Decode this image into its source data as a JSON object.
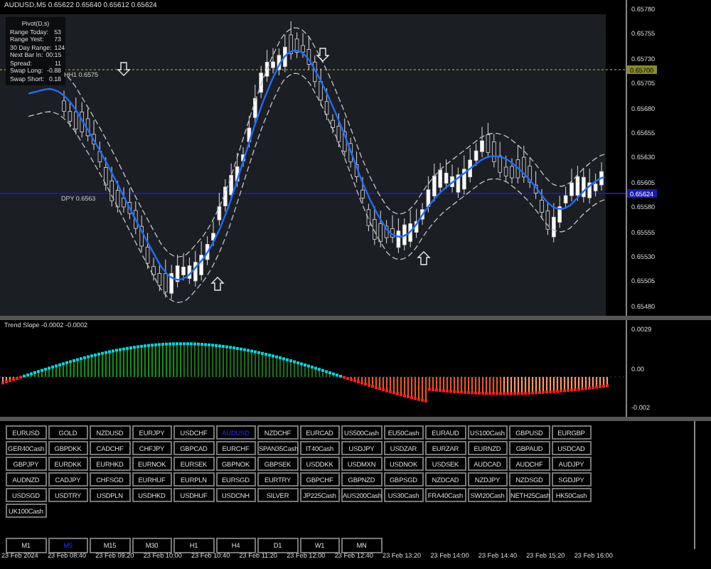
{
  "window": {
    "title": "AUDUSD,M5 0.65622 0.65640 0.65612 0.65624"
  },
  "info_panel": {
    "title": "Pivot(D,s)",
    "rows": [
      {
        "label": "Range Today:",
        "value": "53"
      },
      {
        "label": "Range Yest:",
        "value": "73"
      },
      {
        "label": "30 Day Range:",
        "value": "124"
      },
      {
        "label": "Next Bar In:",
        "value": "00:15"
      },
      {
        "label": "Spread:",
        "value": "11"
      },
      {
        "label": "Swap Long:",
        "value": "-0.88"
      },
      {
        "label": "Swap Short:",
        "value": "0.18"
      }
    ]
  },
  "levels": [
    {
      "kind": "dotted",
      "label": "HH1  0.6575",
      "price_label": "0.65700"
    },
    {
      "kind": "solid",
      "label": "DPY  0.6563",
      "price_label": "0.65624"
    }
  ],
  "price_axis": [
    "0.65780",
    "0.65755",
    "0.65730",
    "0.65705",
    "0.65680",
    "0.65655",
    "0.65630",
    "0.65605",
    "0.65580",
    "0.65555",
    "0.65530",
    "0.65505",
    "0.65480"
  ],
  "indicator": {
    "title": "Trend Slope -0.0002 -0.0002",
    "axis": [
      "0.0029",
      "0.00",
      "-0.002"
    ]
  },
  "symbols": [
    {
      "label": "EURUSD",
      "selected": false
    },
    {
      "label": "GOLD",
      "selected": false
    },
    {
      "label": "NZDUSD",
      "selected": false
    },
    {
      "label": "EURJPY",
      "selected": false
    },
    {
      "label": "USDCHF",
      "selected": false
    },
    {
      "label": "AUDUSD",
      "selected": true
    },
    {
      "label": "NZDCHF",
      "selected": false
    },
    {
      "label": "EURCAD",
      "selected": false
    },
    {
      "label": "US500Cash",
      "selected": false
    },
    {
      "label": "EU50Cash",
      "selected": false
    },
    {
      "label": "EURAUD",
      "selected": false
    },
    {
      "label": "US100Cash",
      "selected": false
    },
    {
      "label": "GBPUSD",
      "selected": false
    },
    {
      "label": "EURGBP",
      "selected": false
    },
    {
      "label": "GER40Cash",
      "selected": false
    },
    {
      "label": "GBPDKK",
      "selected": false
    },
    {
      "label": "CADCHF",
      "selected": false
    },
    {
      "label": "CHFJPY",
      "selected": false
    },
    {
      "label": "GBPCAD",
      "selected": false
    },
    {
      "label": "EURCHF",
      "selected": false
    },
    {
      "label": "SPAN35Cash",
      "selected": false
    },
    {
      "label": "IT40Cash",
      "selected": false
    },
    {
      "label": "USDJPY",
      "selected": false
    },
    {
      "label": "USDZAR",
      "selected": false
    },
    {
      "label": "EURZAR",
      "selected": false
    },
    {
      "label": "EURNZD",
      "selected": false
    },
    {
      "label": "GBPAUD",
      "selected": false
    },
    {
      "label": "USDCAD",
      "selected": false
    },
    {
      "label": "GBPJPY",
      "selected": false
    },
    {
      "label": "EURDKK",
      "selected": false
    },
    {
      "label": "EURHKD",
      "selected": false
    },
    {
      "label": "EURNOK",
      "selected": false
    },
    {
      "label": "EURSEK",
      "selected": false
    },
    {
      "label": "GBPNOK",
      "selected": false
    },
    {
      "label": "GBPSEK",
      "selected": false
    },
    {
      "label": "USDDKK",
      "selected": false
    },
    {
      "label": "USDMXN",
      "selected": false
    },
    {
      "label": "USDNOK",
      "selected": false
    },
    {
      "label": "USDSEK",
      "selected": false
    },
    {
      "label": "AUDCAD",
      "selected": false
    },
    {
      "label": "AUDCHF",
      "selected": false
    },
    {
      "label": "AUDJPY",
      "selected": false
    },
    {
      "label": "AUDNZD",
      "selected": false
    },
    {
      "label": "CADJPY",
      "selected": false
    },
    {
      "label": "CHFSGD",
      "selected": false
    },
    {
      "label": "EURHUF",
      "selected": false
    },
    {
      "label": "EURPLN",
      "selected": false
    },
    {
      "label": "EURSGD",
      "selected": false
    },
    {
      "label": "EURTRY",
      "selected": false
    },
    {
      "label": "GBPCHF",
      "selected": false
    },
    {
      "label": "GBPNZD",
      "selected": false
    },
    {
      "label": "GBPSGD",
      "selected": false
    },
    {
      "label": "NZDCAD",
      "selected": false
    },
    {
      "label": "NZDJPY",
      "selected": false
    },
    {
      "label": "NZDSGD",
      "selected": false
    },
    {
      "label": "SGDJPY",
      "selected": false
    },
    {
      "label": "USDSGD",
      "selected": false
    },
    {
      "label": "USDTRY",
      "selected": false
    },
    {
      "label": "USDPLN",
      "selected": false
    },
    {
      "label": "USDHKD",
      "selected": false
    },
    {
      "label": "USDHUF",
      "selected": false
    },
    {
      "label": "USDCNH",
      "selected": false
    },
    {
      "label": "SILVER",
      "selected": false
    },
    {
      "label": "JP225Cash",
      "selected": false
    },
    {
      "label": "AUS200Cash",
      "selected": false
    },
    {
      "label": "US30Cash",
      "selected": false
    },
    {
      "label": "FRA40Cash",
      "selected": false
    },
    {
      "label": "SWI20Cash",
      "selected": false
    },
    {
      "label": "NETH25Cash",
      "selected": false
    },
    {
      "label": "HK50Cash",
      "selected": false
    },
    {
      "label": "UK100Cash",
      "selected": false
    }
  ],
  "timeframes": [
    {
      "label": "M1",
      "selected": false
    },
    {
      "label": "M5",
      "selected": true
    },
    {
      "label": "M15",
      "selected": false
    },
    {
      "label": "M30",
      "selected": false
    },
    {
      "label": "H1",
      "selected": false
    },
    {
      "label": "H4",
      "selected": false
    },
    {
      "label": "D1",
      "selected": false
    },
    {
      "label": "W1",
      "selected": false
    },
    {
      "label": "MN",
      "selected": false
    }
  ],
  "time_axis": [
    "23 Feb 2024",
    "23 Feb 08:40",
    "23 Feb 09:20",
    "23 Feb 10:00",
    "23 Feb 10:40",
    "23 Feb 11:20",
    "23 Feb 12:00",
    "23 Feb 12:40",
    "23 Feb 13:20",
    "23 Feb 14:00",
    "23 Feb 14:40",
    "23 Feb 15:20",
    "23 Feb 16:00"
  ]
}
